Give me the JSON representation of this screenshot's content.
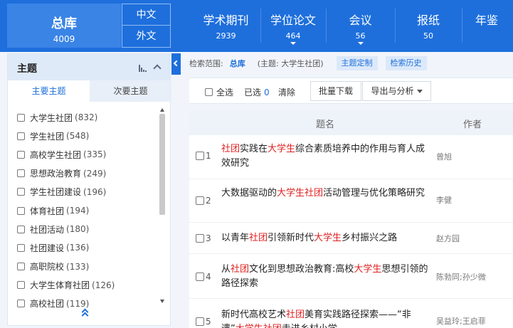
{
  "top_nav": {
    "all": {
      "label": "总库",
      "count": "4009"
    },
    "lang_cn": "中文",
    "lang_en": "外文",
    "items": [
      {
        "label": "学术期刊",
        "count": "2939",
        "caret": false
      },
      {
        "label": "学位论文",
        "count": "464",
        "caret": true
      },
      {
        "label": "会议",
        "count": "56",
        "caret": true
      },
      {
        "label": "报纸",
        "count": "50",
        "caret": false
      },
      {
        "label": "年鉴",
        "count": "",
        "caret": false
      }
    ]
  },
  "facet_panel": {
    "title": "主题",
    "tab_primary": "主要主题",
    "tab_secondary": "次要主题",
    "items": [
      {
        "label": "大学生社团",
        "count": "(832)"
      },
      {
        "label": "学生社团",
        "count": "(548)"
      },
      {
        "label": "高校学生社团",
        "count": "(335)"
      },
      {
        "label": "思想政治教育",
        "count": "(249)"
      },
      {
        "label": "学生社团建设",
        "count": "(196)"
      },
      {
        "label": "体育社团",
        "count": "(194)"
      },
      {
        "label": "社团活动",
        "count": "(180)"
      },
      {
        "label": "社团建设",
        "count": "(136)"
      },
      {
        "label": "高职院校",
        "count": "(133)"
      },
      {
        "label": "大学生体育社团",
        "count": "(126)"
      },
      {
        "label": "高校社团",
        "count": "(119)"
      }
    ],
    "scroll_fraction": 0.33
  },
  "scope": {
    "label": "检索范围:",
    "value": "总库",
    "condition": "(主题: 大学生社团)",
    "btn_custom": "主题定制",
    "btn_history": "检索历史"
  },
  "toolbar": {
    "select_all": "全选",
    "selected_label": "已选",
    "selected_count": "0",
    "clear": "清除",
    "batch_download": "批量下载",
    "export": "导出与分析"
  },
  "results": {
    "col_title": "题名",
    "col_author": "作者",
    "rows": [
      {
        "index": "1",
        "title_parts": [
          {
            "t": "社团",
            "h": true
          },
          {
            "t": "实践在",
            "h": false
          },
          {
            "t": "大学生",
            "h": true
          },
          {
            "t": "综合素质培养中的作用与育人成效研究",
            "h": false
          }
        ],
        "author": "曾旭"
      },
      {
        "index": "2",
        "title_parts": [
          {
            "t": "大数据驱动的",
            "h": false
          },
          {
            "t": "大学生社团",
            "h": true
          },
          {
            "t": "活动管理与优化策略研究",
            "h": false
          }
        ],
        "author": "李健"
      },
      {
        "index": "3",
        "title_parts": [
          {
            "t": "以青年",
            "h": false
          },
          {
            "t": "社团",
            "h": true
          },
          {
            "t": "引领新时代",
            "h": false
          },
          {
            "t": "大学生",
            "h": true
          },
          {
            "t": "乡村振兴之路",
            "h": false
          }
        ],
        "author": "赵方园"
      },
      {
        "index": "4",
        "title_parts": [
          {
            "t": "从",
            "h": false
          },
          {
            "t": "社团",
            "h": true
          },
          {
            "t": "文化到思想政治教育:高校",
            "h": false
          },
          {
            "t": "大学生",
            "h": true
          },
          {
            "t": "思想引领的路径探索",
            "h": false
          }
        ],
        "author": "陈勃同;孙少微"
      },
      {
        "index": "5",
        "title_parts": [
          {
            "t": "新时代高校艺术",
            "h": false
          },
          {
            "t": "社团",
            "h": true
          },
          {
            "t": "美育实践路径探索——“非遗”",
            "h": false
          },
          {
            "t": "大学生社团",
            "h": true
          },
          {
            "t": "走进乡村小学",
            "h": false
          }
        ],
        "author": "吴益玲;王启菲"
      }
    ]
  }
}
